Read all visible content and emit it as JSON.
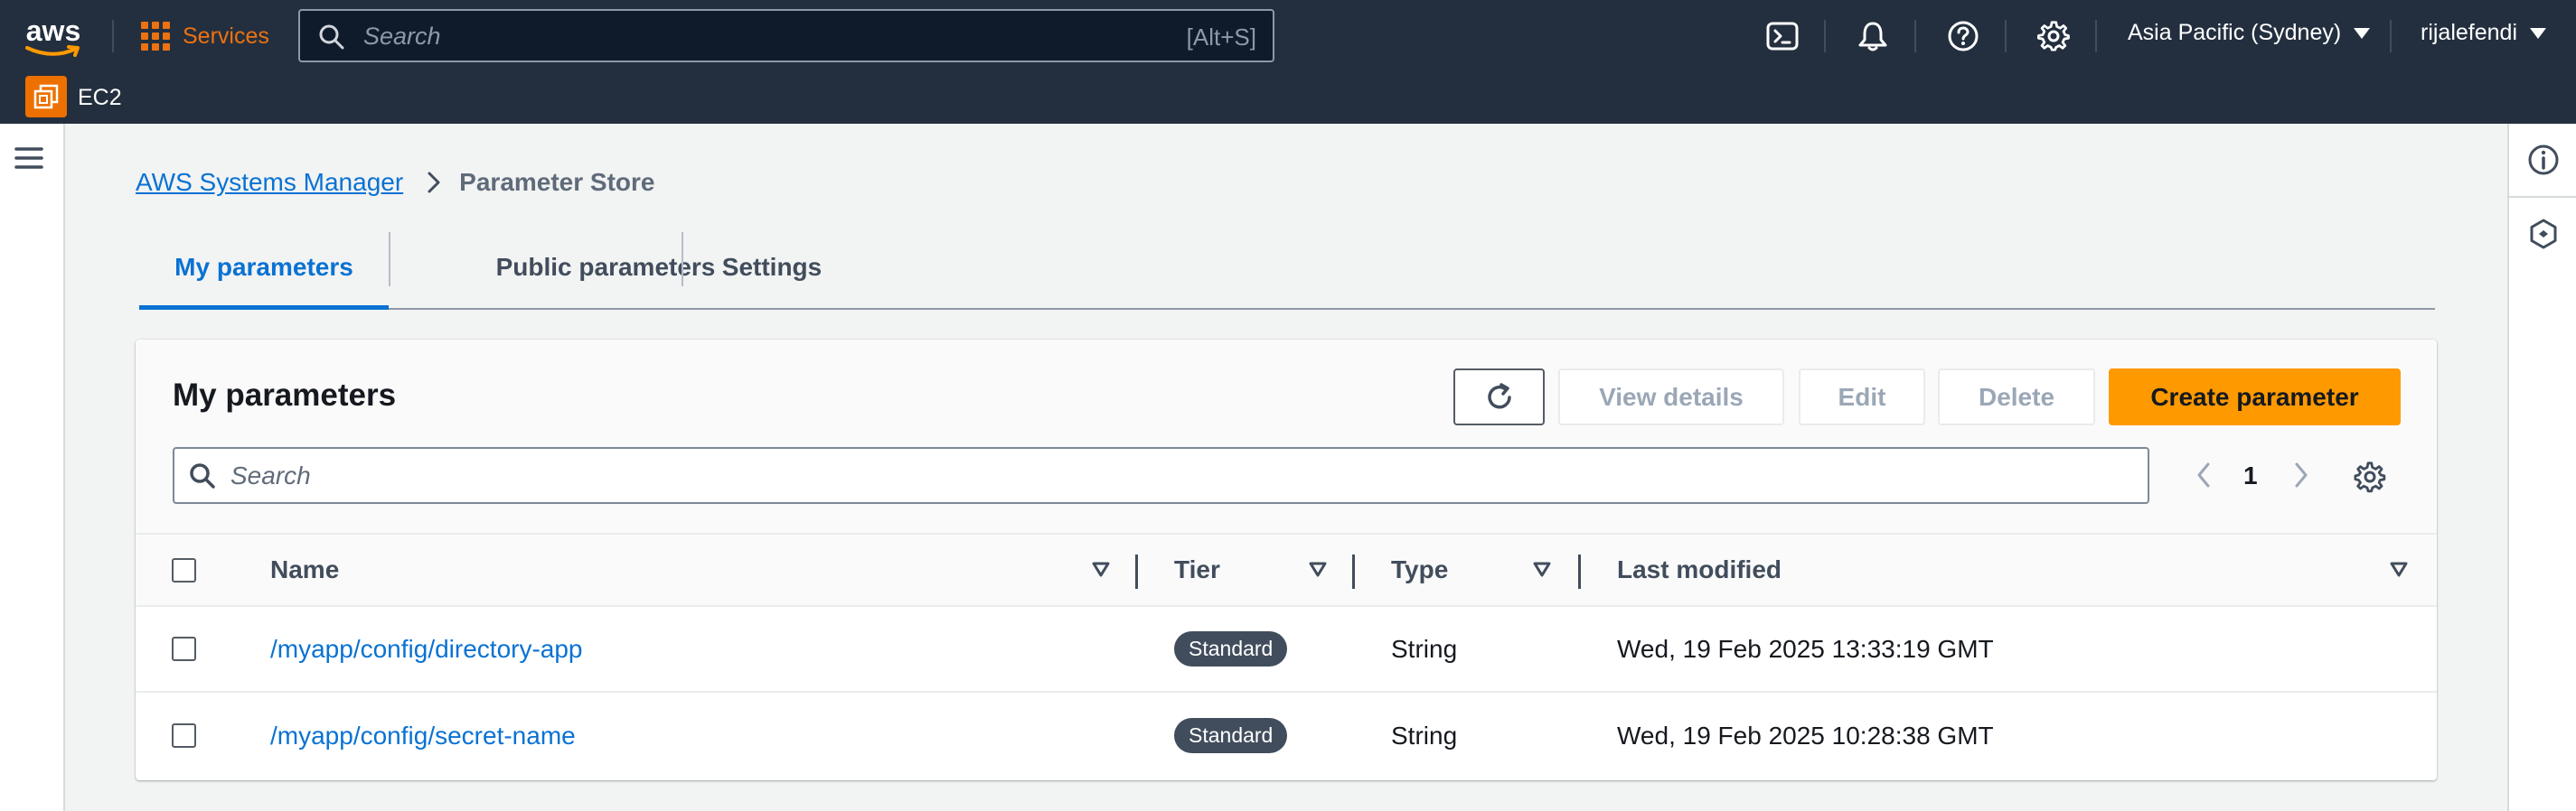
{
  "topnav": {
    "logo_text": "aws",
    "services_label": "Services",
    "search_placeholder": "Search",
    "search_shortcut": "[Alt+S]",
    "region_label": "Asia Pacific (Sydney)",
    "username": "rijalefendi",
    "service_badge_label": "EC2",
    "icons": [
      "cloudshell-icon",
      "bell-icon",
      "help-icon",
      "settings-gear-icon"
    ],
    "accent_color": "#ec7211",
    "bg_color": "#232f3e"
  },
  "breadcrumb": {
    "parent": "AWS Systems Manager",
    "current": "Parameter Store"
  },
  "tabs": [
    {
      "label": "My parameters",
      "active": true
    },
    {
      "label": "Public parameters",
      "active": false
    },
    {
      "label": "Settings",
      "active": false
    }
  ],
  "panel": {
    "title": "My parameters",
    "buttons": {
      "view_details": "View details",
      "edit": "Edit",
      "delete": "Delete",
      "create": "Create parameter"
    },
    "search_placeholder": "Search",
    "current_page": "1"
  },
  "table": {
    "columns": [
      "Name",
      "Tier",
      "Type",
      "Last modified"
    ],
    "rows": [
      {
        "name": "/myapp/config/directory-app",
        "tier": "Standard",
        "type": "String",
        "last_modified": "Wed, 19 Feb 2025 13:33:19 GMT"
      },
      {
        "name": "/myapp/config/secret-name",
        "tier": "Standard",
        "type": "String",
        "last_modified": "Wed, 19 Feb 2025 10:28:38 GMT"
      }
    ]
  },
  "colors": {
    "link": "#0972d3",
    "primary_button": "#ff9900",
    "badge_bg": "#414d5c"
  }
}
